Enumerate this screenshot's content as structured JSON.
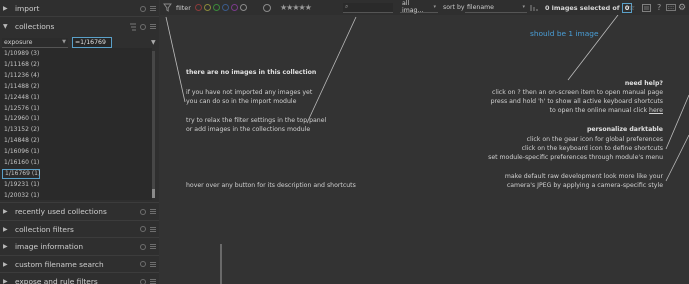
{
  "left_panel": {
    "import": {
      "label": "import"
    },
    "collections": {
      "label": "collections",
      "rule": {
        "property": "exposure",
        "value": "=1/16769"
      },
      "items": [
        "1/10989 (3)",
        "1/11168 (2)",
        "1/11236 (4)",
        "1/11488 (2)",
        "1/12448 (1)",
        "1/12576 (1)",
        "1/12960 (1)",
        "1/13152 (2)",
        "1/14848 (2)",
        "1/16096 (1)",
        "1/16160 (1)",
        "1/16769 (1)",
        "1/19231 (1)",
        "1/20032 (1)"
      ],
      "selected_index": 11
    },
    "modules": [
      "recently used collections",
      "collection filters",
      "image information",
      "custom filename search",
      "expose and rule filters"
    ]
  },
  "toolbar": {
    "filter_label": "filter",
    "stars": "★★★★★",
    "search_placeholder": "search",
    "filter_value": "all imag...",
    "sort_label": "sort by",
    "sort_value": "filename",
    "images_selected_prefix": "0 images selected of",
    "images_selected_count": "0"
  },
  "main": {
    "annotation": "should be 1 image",
    "empty_title": "there are no images in this collection",
    "empty_line1": "if you have not imported any images yet",
    "empty_line2": "you can do so in the import module",
    "relax_line1": "try to relax the filter settings in the top panel",
    "relax_line2": "or add images in the collections module",
    "hover_hint": "hover over any button for its description and shortcuts",
    "help_title": "need help?",
    "help_line1": "click on ? then an on-screen item to open manual page",
    "help_line2": "press and hold 'h' to show all active keyboard shortcuts",
    "help_line3_prefix": "to open the online manual click ",
    "help_line3_link": "here",
    "personalize_title": "personalize darktable",
    "pers_line1": "click on the gear icon for global preferences",
    "pers_line2": "click on the keyboard icon to define shortcuts",
    "pers_line3": "set module-specific preferences through module's menu",
    "raw_line1": "make default raw development look more like your",
    "raw_line2": "camera's JPEG by applying a camera-specific style"
  },
  "colors": {
    "accent": "#5aa0c8",
    "annotation": "#4a9fd8",
    "panel": "#2f2f2f",
    "background": "#333333"
  },
  "icons": [
    "triangle-right-icon",
    "triangle-down-icon",
    "reset-circle-icon",
    "presets-menu-icon",
    "sort-icon",
    "filter-funnel-icon",
    "color-label-icon",
    "star-icon",
    "search-icon",
    "star-toolbar-icon",
    "grouping-icon",
    "help-icon",
    "keyboard-icon",
    "gear-icon"
  ]
}
